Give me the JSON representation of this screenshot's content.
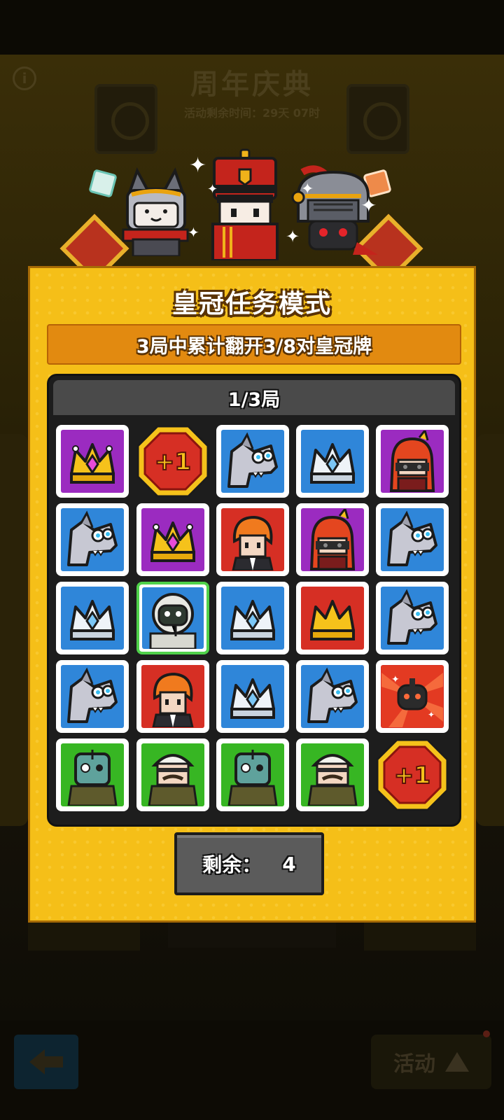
{
  "background": {
    "event_title": "周年庆典",
    "event_timer": "活动剩余时间：29天 07时",
    "info_icon": "info-icon"
  },
  "panel": {
    "title": "皇冠任务模式",
    "mission": "3局中累计翻开3/8对皇冠牌",
    "round": "1/3局",
    "remaining_label": "剩余：",
    "remaining_value": "4"
  },
  "grid": {
    "rows": 5,
    "cols": 5,
    "cards": [
      [
        "gold-crown-purple",
        "plus-one",
        "wolf-blue",
        "silver-crown-blue",
        "red-hair-girl-purple"
      ],
      [
        "wolf-blue",
        "gold-crown-purple",
        "orange-hair-man-red",
        "red-hair-girl-purple",
        "wolf-blue"
      ],
      [
        "silver-crown-blue",
        "astronaut-blue-selected",
        "silver-crown-blue",
        "gold-crown-red",
        "wolf-blue"
      ],
      [
        "wolf-blue",
        "orange-hair-man-red",
        "silver-crown-blue",
        "wolf-blue",
        "robot-burst-red"
      ],
      [
        "zombie-green",
        "mustache-man-green",
        "zombie-green",
        "mustache-man-green",
        "plus-one"
      ]
    ],
    "plus_label": "+1"
  },
  "bottom_bar": {
    "back_icon": "arrow-left-icon",
    "activity_label": "活动",
    "activity_icon": "triangle-up-icon"
  },
  "colors": {
    "panel": "#f5bf18",
    "mission_bar": "#e28a10",
    "board": "#1d1d1d",
    "selected_border": "#4fd14a"
  }
}
